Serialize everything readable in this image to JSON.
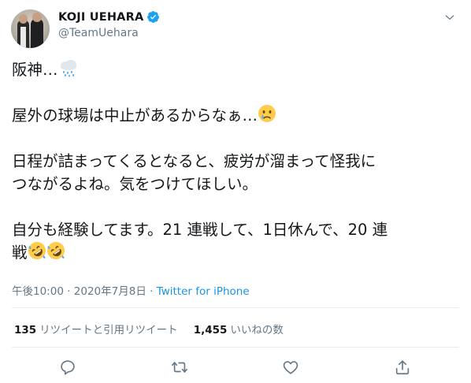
{
  "user": {
    "display_name": "KOJI UEHARA",
    "handle": "@TeamUehara"
  },
  "tweet": {
    "line1": "阪神…",
    "line2": "屋外の球場は中止があるからなぁ…",
    "line3": "日程が詰まってくるとなると、疲労が溜まって怪我に\nつながるよね。気をつけてほしい。",
    "line4": "自分も経験してます。21 連戦して、1日休んで、20 連\n戦",
    "icons": [
      "cloud-with-rain-emoji",
      "crying-face-emoji",
      "rolling-on-floor-laughing-emoji",
      "rolling-on-floor-laughing-emoji"
    ]
  },
  "meta": {
    "time": "午後10:00",
    "separator1": " · ",
    "date": "2020年7月8日",
    "separator2": " · ",
    "source": "Twitter for iPhone"
  },
  "stats": {
    "retweets_count": "135",
    "retweets_label": "リツイートと引用リツイート",
    "likes_count": "1,455",
    "likes_label": "いいねの数"
  },
  "actions": [
    "reply-icon",
    "retweet-icon",
    "like-icon",
    "share-icon"
  ],
  "colors": {
    "text": "#14171a",
    "secondary": "#657786",
    "link": "#1b95e0",
    "verified": "#1da1f2",
    "divider": "#e6ecf0"
  }
}
